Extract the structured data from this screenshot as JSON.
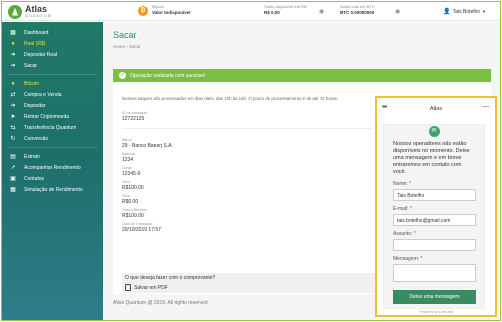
{
  "header": {
    "logo_title": "Atlas",
    "logo_sub": "QUANTUM",
    "btc_label": "Bitcoin",
    "btc_value": "Valor Indisponível",
    "balance_brl_label": "Saldo disponível em R$",
    "balance_brl_value": "R$ 0,00",
    "balance_btc_label": "Saldo total em BTC",
    "balance_btc_value": "BTC 0.00000000",
    "user_name": "Tais Botelho"
  },
  "sidebar": {
    "items": [
      {
        "label": "Dashboard",
        "icon": "grid-icon",
        "active": false
      },
      {
        "label": "Real (R$)",
        "icon": "coin-icon",
        "active": true
      },
      {
        "label": "Depositar Real",
        "icon": "deposit-icon",
        "active": false
      },
      {
        "label": "Sacar",
        "icon": "withdraw-icon",
        "active": false
      }
    ],
    "items2": [
      {
        "label": "Bitcoin",
        "icon": "bitcoin-icon",
        "active": true
      },
      {
        "label": "Compra e Venda",
        "icon": "cart-icon",
        "active": false
      },
      {
        "label": "Depositar",
        "icon": "deposit-icon",
        "active": false
      },
      {
        "label": "Retirar Criptomoeda",
        "icon": "send-icon",
        "active": false
      },
      {
        "label": "Transferência Quantum",
        "icon": "transfer-icon",
        "active": false
      },
      {
        "label": "Conversão",
        "icon": "convert-icon",
        "active": false
      }
    ],
    "items3": [
      {
        "label": "Extrato",
        "icon": "statement-icon",
        "active": false
      },
      {
        "label": "Acompanhar Rendimento",
        "icon": "chart-icon",
        "active": false
      },
      {
        "label": "Contatos",
        "icon": "contacts-icon",
        "active": false
      },
      {
        "label": "Simulação de Rendimento",
        "icon": "calculator-icon",
        "active": false
      }
    ]
  },
  "main": {
    "title": "Sacar",
    "breadcrumb": "Home  ›  Sacar",
    "alert": "Operação realizada com sucesso!",
    "note": "Nossos saques são processados em dias úteis, das 10h às 16h. O prazo de processamento é de até 72 horas.",
    "tx_id_label": "ID da transação",
    "tx_id_value": "12722125",
    "bank_label": "Banco",
    "bank_value": "29 - Banco Banerj S.A.",
    "agency_label": "Agência",
    "agency_value": "1234",
    "account_label": "Conta",
    "account_value": "12345-9",
    "amount_label": "Valor",
    "amount_value": "R$100.00",
    "fee_label": "Taxa",
    "fee_value": "R$0.00",
    "total_label": "Total a Receber",
    "total_value": "R$100.00",
    "date_label": "Data da Transação",
    "date_value": "20/10/2019 17:57",
    "question": "O que deseja fazer com o comprovante?",
    "pdf_label": "Salvar em PDF",
    "footer": "Atlas Quantum @ 2019. All rights reserved"
  },
  "chat": {
    "title": "Atlas",
    "message": "Nossos operadores não estão disponíveis no momento. Deixe uma mensagem e em breve entraremos em contato com você.",
    "name_label": "Nome:",
    "name_value": "Tais Botelho",
    "email_label": "E-mail:",
    "email_value": "tais.botelho@gmail.com",
    "subject_label": "Assunto:",
    "message_label": "Mensagem:",
    "send_label": "Deixe uma mensagem",
    "powered": "Powered by LiveChat",
    "required_mark": "*"
  }
}
